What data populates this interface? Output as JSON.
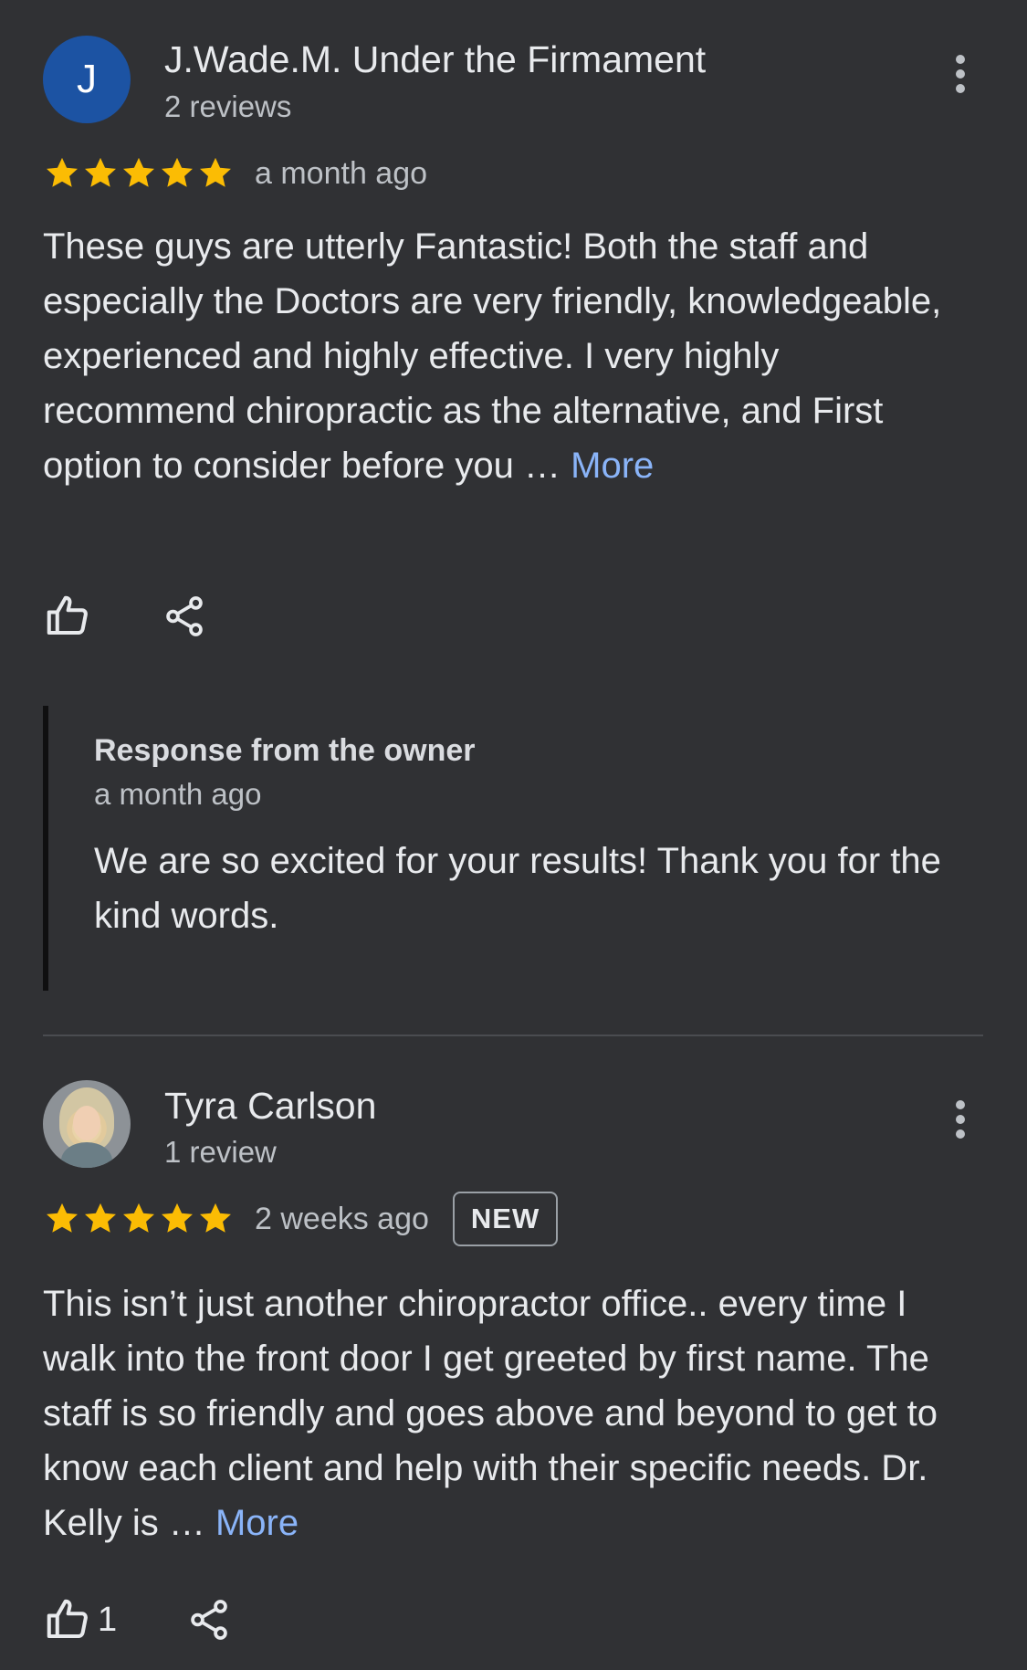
{
  "reviews": [
    {
      "avatar_letter": "J",
      "avatar_color": "#1c53a3",
      "name": "J.Wade.M. Under the Firmament",
      "review_count": "2 reviews",
      "rating": 5,
      "time": "a month ago",
      "badge": "",
      "text": "These guys are utterly Fantastic! Both the staff and especially the Doctors are very friendly, knowledgeable, experienced and highly effective. I very highly recommend chiropractic as the alternative, and First option to consider before you …",
      "more": "More",
      "likes": "",
      "owner_response": {
        "title": "Response from the owner",
        "time": "a month ago",
        "text": "We are so excited for your results! Thank you for the kind words."
      }
    },
    {
      "avatar_letter": "",
      "name": "Tyra Carlson",
      "review_count": "1 review",
      "rating": 5,
      "time": "2 weeks ago",
      "badge": "NEW",
      "text": "This isn’t just another chiropractor office.. every time I walk into the front door I get greeted by first name. The staff is so friendly and goes above and beyond to get to know each client and help with their specific needs. Dr. Kelly is …",
      "more": "More",
      "likes": "1"
    }
  ],
  "colors": {
    "background": "#303134",
    "star": "#fbbc04",
    "link": "#8ab4f8"
  },
  "icons": {
    "like": "thumb-up-icon",
    "share": "share-icon",
    "menu": "more-vert-icon",
    "star": "star-icon"
  }
}
